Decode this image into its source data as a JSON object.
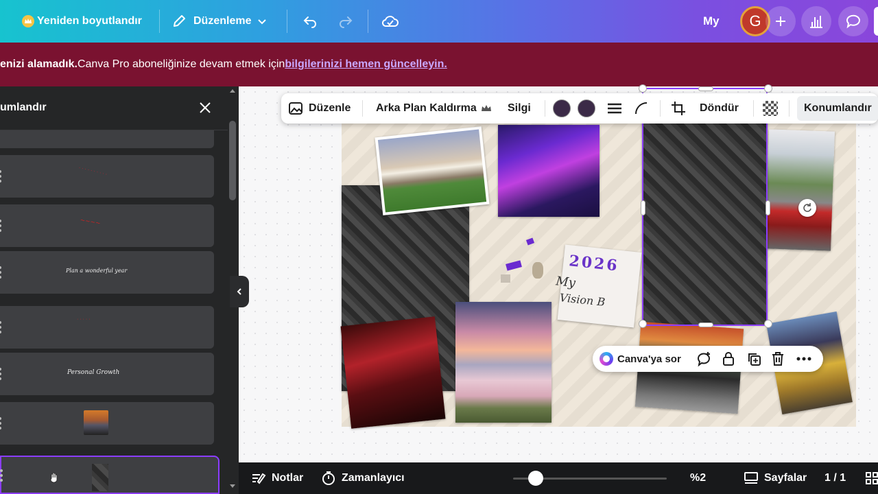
{
  "topbar": {
    "resize_label": "Yeniden boyutlandır",
    "edit_label": "Düzenleme",
    "my_label": "My",
    "avatar_initial": "G"
  },
  "banner": {
    "bold_text": "enizi alamadık.",
    "text": " Canva Pro aboneliğinize devam etmek için ",
    "link_text": "bilgilerinizi hemen güncelleyin."
  },
  "left_panel": {
    "title": "umlandır",
    "layers": [
      {
        "thumb_text": "· · · · · · · · · ·"
      },
      {
        "thumb_text": "~~~~"
      },
      {
        "thumb_text": "Plan a wonderful year"
      },
      {
        "thumb_text": "· · · · ·"
      },
      {
        "thumb_text": "Personal Growth"
      },
      {
        "thumb_text": ""
      },
      {
        "thumb_text": ""
      }
    ]
  },
  "float_toolbar": {
    "edit_label": "Düzenle",
    "bg_remove_label": "Arka Plan Kaldırma",
    "erase_label": "Silgi",
    "rotate_label": "Döndür",
    "position_label": "Konumlandır",
    "swatch_color": "#3b2a47"
  },
  "canvas": {
    "sticker_text": "2026",
    "script_text": "Vision B",
    "my_text": "My"
  },
  "context_pill": {
    "ask_label": "Canva'ya sor"
  },
  "bottombar": {
    "notes_label": "Notlar",
    "timer_label": "Zamanlayıcı",
    "zoom_value": "%2",
    "pages_label": "Sayfalar",
    "page_count": "1 / 1"
  },
  "colors": {
    "accent": "#8b3dff",
    "banner_bg": "#7a1230",
    "link": "#c9a7ff"
  }
}
